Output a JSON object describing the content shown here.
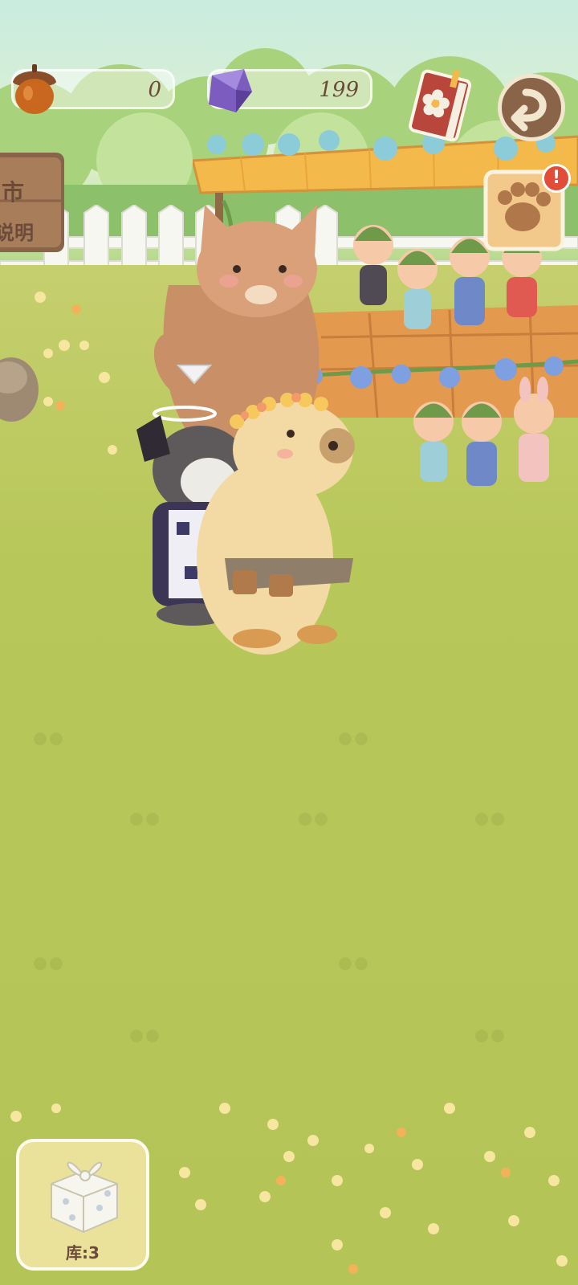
{
  "hud": {
    "acorn_count": "0",
    "gem_count": "199",
    "acorn_icon": "acorn-icon",
    "gem_icon": "purple-gem-icon",
    "book_icon": "flower-book-icon",
    "back_icon": "return-arrow-icon"
  },
  "sign": {
    "line1": "市",
    "line2": "说明"
  },
  "storage": {
    "icon": "gift-box-icon",
    "label": "库:3"
  },
  "quest": {
    "icon": "paw-note-icon",
    "alert": "!"
  },
  "colors": {
    "grass": "#b7c759",
    "brown_text": "#6b4a3a",
    "awning": "#f3b94a",
    "alert_red": "#e24d3a"
  }
}
